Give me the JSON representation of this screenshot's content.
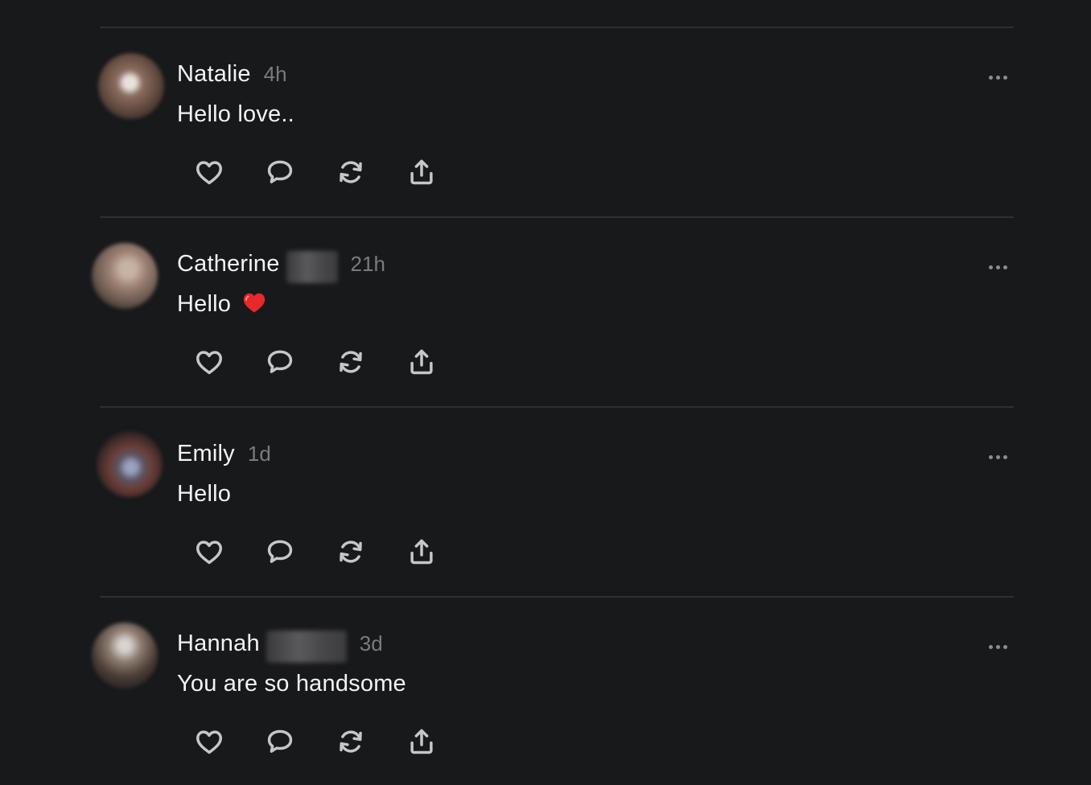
{
  "posts": [
    {
      "author": "Natalie",
      "time": "4h",
      "text": "Hello love..",
      "emoji": ""
    },
    {
      "author": "Catherine",
      "time": "21h",
      "text": "Hello",
      "emoji": "❤️"
    },
    {
      "author": "Emily",
      "time": "1d",
      "text": "Hello",
      "emoji": ""
    },
    {
      "author": "Hannah",
      "time": "3d",
      "text": "You are so handsome",
      "emoji": ""
    }
  ],
  "icons": {
    "like": "heart-icon",
    "reply": "comment-icon",
    "repost": "repost-icon",
    "share": "share-icon",
    "more": "more-options-icon"
  },
  "colors": {
    "background": "#18191b",
    "divider": "#2e2f32",
    "text": "#f3f3f3",
    "secondary": "#7a7b7f",
    "icon": "#c6c7ca"
  }
}
